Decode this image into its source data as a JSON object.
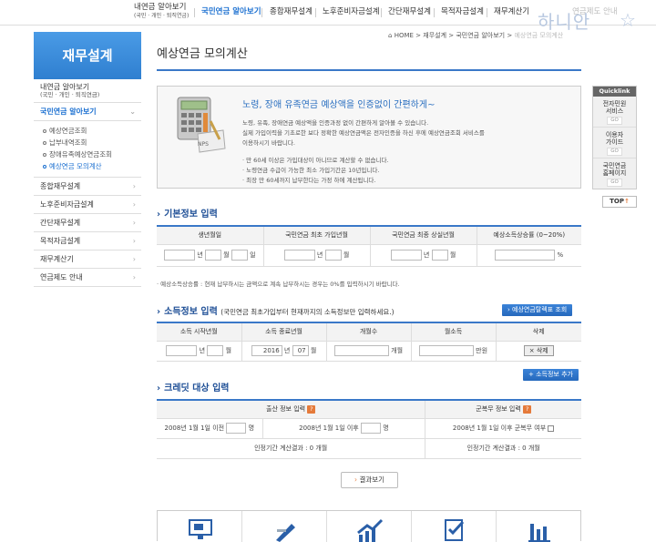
{
  "topnav": {
    "items": [
      {
        "label": "내연금 알아보기",
        "sub": "(국민 · 개인 · 퇴직연금)"
      },
      {
        "label": "국민연금 알아보기"
      },
      {
        "label": "종합재무설계"
      },
      {
        "label": "노후준비자금설계"
      },
      {
        "label": "간단재무설계"
      },
      {
        "label": "목적자금설계"
      },
      {
        "label": "재무계산기"
      },
      {
        "label": "연금제도 안내"
      }
    ],
    "logo": "하니안",
    "colors": {
      "accent": "#1a6fd0",
      "logo": "#b8c8e0"
    }
  },
  "breadcrumb": [
    "HOME",
    "재무설계",
    "국민연금 알아보기",
    "예상연금 모의계산"
  ],
  "sidebar": {
    "title": "재무설계",
    "first": {
      "label": "내연금 알아보기",
      "sub": "(국민 · 개인 · 퇴직연금)"
    },
    "active": "국민연금 알아보기",
    "subitems": [
      "예상연금조회",
      "납부내역조회",
      "장애유족예상연금조회",
      "예상연금 모의계산"
    ],
    "items": [
      "종합재무설계",
      "노후준비자금설계",
      "간단재무설계",
      "목적자금설계",
      "재무계산기",
      "연금제도 안내"
    ]
  },
  "page_title": "예상연금 모의계산",
  "intro": {
    "headline": "노령, 장애 유족연금 예상액을 인증없이 간편하게~",
    "para1": "노령, 유족, 장애연금 예상액을 인증과정 없이 간편하게 알아볼 수 있습니다.",
    "para2": "실제 가입이력을 기초로한 보다 정확한 예상연금액은 전자인증을 하신 후에 예상연금조회 서비스를",
    "para3": "이용하시기 바랍니다.",
    "bullets": [
      "· 만 60세 이상은 가입대상이 아니므로 계산할 수 없습니다.",
      "· 노령연금 수급이 가능한 최소 가입기간은 10년입니다.",
      "· 최장 만 60세까지 납부한다는 가정 하에 계산됩니다."
    ],
    "nps": "NPS"
  },
  "basic": {
    "title": "기본정보 입력",
    "headers": [
      "생년월일",
      "국민연금 최초 가입년월",
      "국민연금 최종 상실년월",
      "예상소득상승률 (0~20%)"
    ],
    "units": {
      "year": "년",
      "month": "월",
      "day": "일",
      "percent": "%"
    },
    "note": "· 예상소득상승률 : 현재 납부하시는 금액으로 계속 납부하시는 경우는 0%를 입력하시기 바랍니다."
  },
  "income": {
    "title": "소득정보 입력",
    "note": "(국민연금 최초가입부터 현재까지의 소득정보만 입력하세요.)",
    "table_button": "예상연금탈렉표 조회",
    "headers": [
      "소득 시작년월",
      "소득 종료년월",
      "개월수",
      "월소득",
      "삭제"
    ],
    "end_year": "2016",
    "end_month": "07",
    "units": {
      "year": "년",
      "month": "월",
      "months": "개월",
      "won": "만원"
    },
    "delete_label": "× 삭제",
    "add_button": "+ 소득정보 추가"
  },
  "credit": {
    "title": "크레딧 대상 입력",
    "headers": [
      "출산 정보 입력",
      "군복무 정보 입력"
    ],
    "help": "?",
    "before": "2008년 1월 1일 이전",
    "after": "2008년 1월 1일 이후",
    "unit": "명",
    "military": "2008년 1월 1일 이후 군복무 여부",
    "period_result_birth": "인정기간 계산결과 : 0 개월",
    "period_result_military": "인정기간 계산결과 : 0 개월"
  },
  "result_button": "결과보기",
  "quick": {
    "title": "Quicklink",
    "items": [
      {
        "label": "전자민원\n서비스",
        "go": "GO"
      },
      {
        "label": "이용자\n가이드",
        "go": "GO"
      },
      {
        "label": "국민연금\n홈페이지",
        "go": "GO"
      }
    ],
    "top": "TOP"
  }
}
